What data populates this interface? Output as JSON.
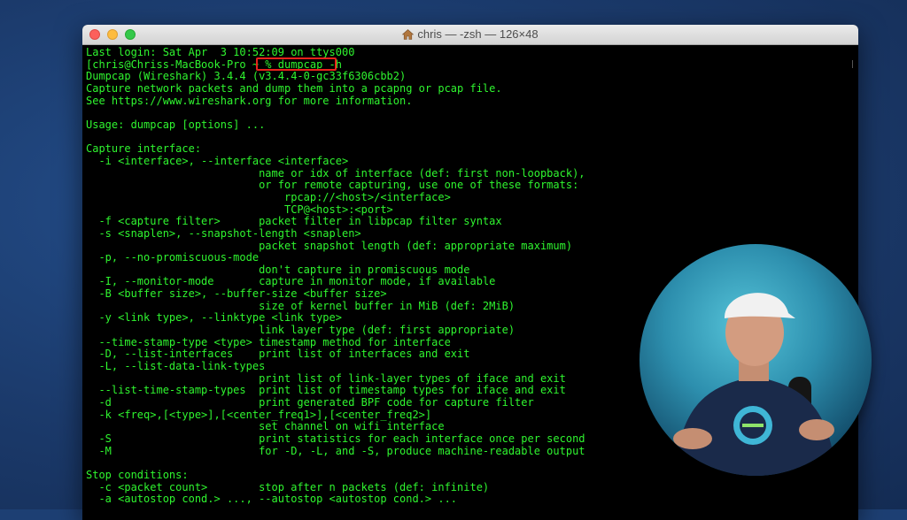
{
  "window": {
    "title": "chris — -zsh — 126×48"
  },
  "terminal": {
    "lines": [
      "Last login: Sat Apr  3 10:52:09 on ttys000",
      "[chris@Chriss-MacBook-Pro ~ % dumpcap -h",
      "Dumpcap (Wireshark) 3.4.4 (v3.4.4-0-gc33f6306cbb2)",
      "Capture network packets and dump them into a pcapng or pcap file.",
      "See https://www.wireshark.org for more information.",
      "",
      "Usage: dumpcap [options] ...",
      "",
      "Capture interface:",
      "  -i <interface>, --interface <interface>",
      "                           name or idx of interface (def: first non-loopback),",
      "                           or for remote capturing, use one of these formats:",
      "                               rpcap://<host>/<interface>",
      "                               TCP@<host>:<port>",
      "  -f <capture filter>      packet filter in libpcap filter syntax",
      "  -s <snaplen>, --snapshot-length <snaplen>",
      "                           packet snapshot length (def: appropriate maximum)",
      "  -p, --no-promiscuous-mode",
      "                           don't capture in promiscuous mode",
      "  -I, --monitor-mode       capture in monitor mode, if available",
      "  -B <buffer size>, --buffer-size <buffer size>",
      "                           size of kernel buffer in MiB (def: 2MiB)",
      "  -y <link type>, --linktype <link type>",
      "                           link layer type (def: first appropriate)",
      "  --time-stamp-type <type> timestamp method for interface",
      "  -D, --list-interfaces    print list of interfaces and exit",
      "  -L, --list-data-link-types",
      "                           print list of link-layer types of iface and exit",
      "  --list-time-stamp-types  print list of timestamp types for iface and exit",
      "  -d                       print generated BPF code for capture filter",
      "  -k <freq>,[<type>],[<center_freq1>],[<center_freq2>]",
      "                           set channel on wifi interface",
      "  -S                       print statistics for each interface once per second",
      "  -M                       for -D, -L, and -S, produce machine-readable output",
      "",
      "Stop conditions:",
      "  -c <packet count>        stop after n packets (def: infinite)",
      "  -a <autostop cond.> ..., --autostop <autostop cond.> ..."
    ]
  },
  "colors": {
    "terminal_text": "#2ff52f",
    "terminal_bg": "#000000",
    "highlight_box": "#e8221b",
    "desktop_bg": "#1d3f73"
  }
}
